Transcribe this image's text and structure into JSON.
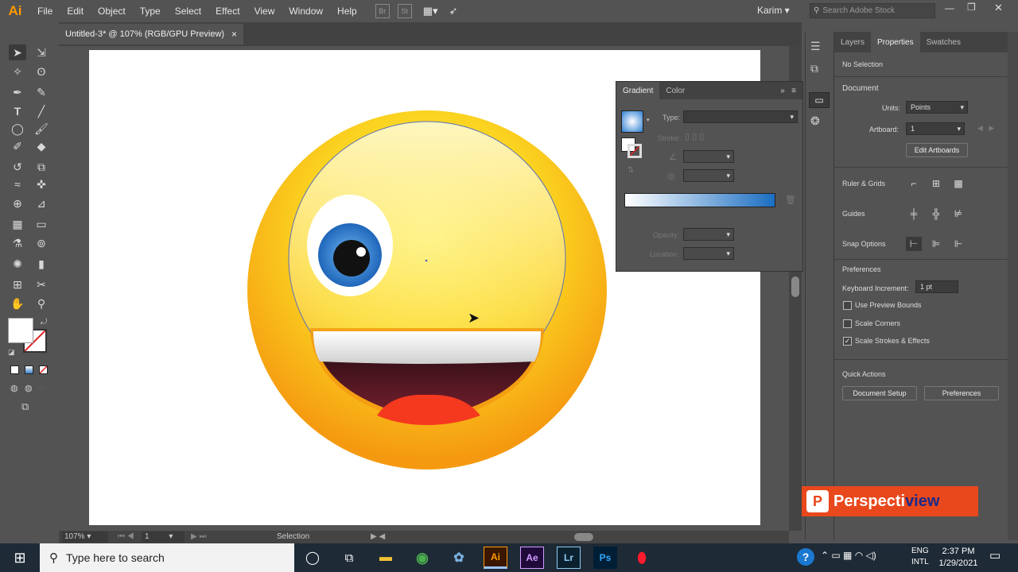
{
  "app": {
    "logo": "Ai"
  },
  "menu": [
    "File",
    "Edit",
    "Object",
    "Type",
    "Select",
    "Effect",
    "View",
    "Window",
    "Help"
  ],
  "bridge": {
    "br": "Br",
    "st": "St"
  },
  "user": {
    "name": "Karim"
  },
  "search_stock": {
    "placeholder": "Search Adobe Stock"
  },
  "document_tab": {
    "title": "Untitled-3* @ 107% (RGB/GPU Preview)",
    "close": "×"
  },
  "gradient_panel": {
    "tabs": [
      "Gradient",
      "Color"
    ],
    "type_label": "Type:",
    "stroke_label": "Stroke:",
    "opacity_label": "Opacity:",
    "location_label": "Location:",
    "gradient_start": "#ffffff",
    "gradient_end": "#1b6ec2"
  },
  "right_panel": {
    "tabs": [
      "Layers",
      "Properties",
      "Swatches"
    ],
    "selection": "No Selection",
    "document_heading": "Document",
    "units_label": "Units:",
    "units_value": "Points",
    "artboard_label": "Artboard:",
    "artboard_value": "1",
    "edit_artboards": "Edit Artboards",
    "ruler_grids": "Ruler & Grids",
    "guides": "Guides",
    "snap_options": "Snap Options",
    "preferences_heading": "Preferences",
    "keyboard_increment_label": "Keyboard Increment:",
    "keyboard_increment_value": "1 pt",
    "use_preview_bounds": "Use Preview Bounds",
    "scale_corners": "Scale Corners",
    "scale_strokes": "Scale Strokes & Effects",
    "quick_actions": "Quick Actions",
    "document_setup": "Document Setup",
    "preferences_button": "Preferences"
  },
  "status_bar": {
    "zoom": "107%",
    "artboard": "1",
    "tool": "Selection"
  },
  "taskbar": {
    "search_placeholder": "Type here to search",
    "lang1": "ENG",
    "lang2": "INTL",
    "time": "2:37 PM",
    "date": "1/29/2021",
    "apps": [
      "Ai",
      "Ae",
      "Lr",
      "Ps"
    ]
  },
  "watermark": {
    "prefix": "Perspecti",
    "suffix": "view",
    "logo": "P"
  },
  "colors": {
    "face_light": "#fff4a0",
    "face_mid": "#fbd421",
    "face_dark": "#f59a10",
    "iris": "#2f7fd0",
    "tongue": "#f5391f",
    "mouth": "#3a0d18"
  }
}
